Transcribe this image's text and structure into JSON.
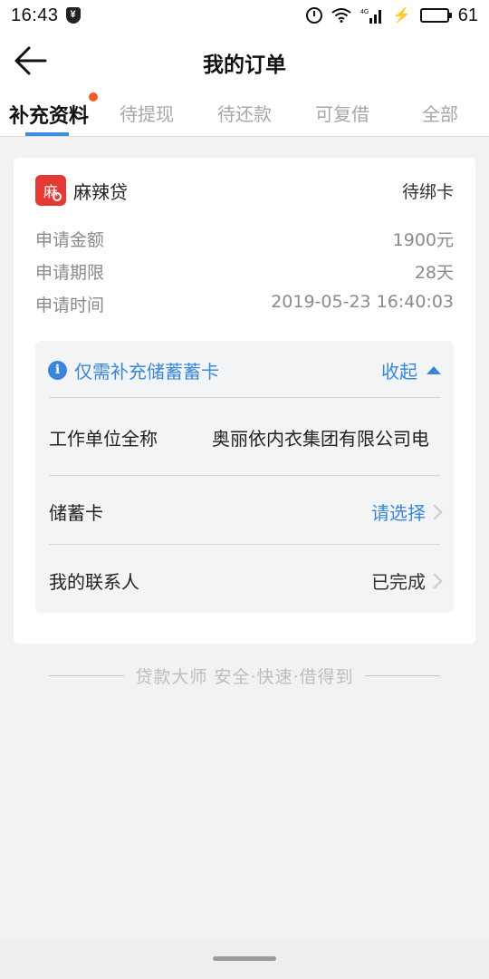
{
  "status_bar": {
    "time": "16:43",
    "battery": "61",
    "network": "4G",
    "icons": [
      "shield-icon",
      "alarm-icon",
      "wifi-icon",
      "signal-icon",
      "charging-icon",
      "battery-icon"
    ]
  },
  "nav": {
    "title": "我的订单",
    "back_icon": "arrow-left-icon"
  },
  "tabs": [
    {
      "label": "补充资料",
      "active": true,
      "badge": true
    },
    {
      "label": "待提现"
    },
    {
      "label": "待还款"
    },
    {
      "label": "可复借"
    },
    {
      "label": "全部"
    }
  ],
  "order": {
    "product_logo_char": "麻",
    "product_name": "麻辣贷",
    "status": "待绑卡",
    "details": [
      {
        "label": "申请金额",
        "value": "1900元"
      },
      {
        "label": "申请期限",
        "value": "28天"
      },
      {
        "label": "申请时间",
        "value": "2019-05-23 16:40:03"
      }
    ],
    "supplement": {
      "hint": "仅需补充储蓄蓄卡",
      "collapse_label": "收起",
      "rows": [
        {
          "label": "工作单位全称",
          "value": "奥丽依内衣集团有限公司电"
        },
        {
          "label": "储蓄卡",
          "value": "请选择"
        },
        {
          "label": "我的联系人",
          "value": "已完成"
        }
      ]
    }
  },
  "footer": {
    "slogan": "贷款大师 安全·快速·借得到"
  },
  "colors": {
    "accent": "#3a86d8",
    "badge": "#f05a28",
    "logo": "#e53935",
    "background": "#f2f2f2"
  }
}
